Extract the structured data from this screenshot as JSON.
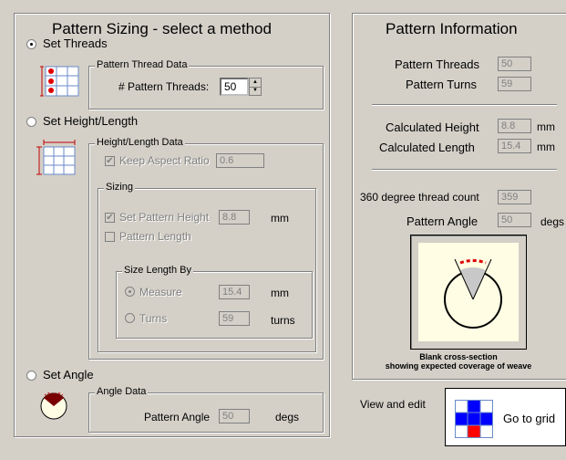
{
  "sizing": {
    "title": "Pattern Sizing - select a method",
    "set_threads": {
      "label": "Set Threads",
      "selected": true,
      "group_label": "Pattern Thread Data",
      "threads_label": "# Pattern Threads:",
      "threads_value": "50"
    },
    "set_height_length": {
      "label": "Set Height/Length",
      "selected": false,
      "group_label": "Height/Length Data",
      "keep_aspect_label": "Keep Aspect Ratio",
      "keep_aspect_checked": true,
      "aspect_value": "0.6",
      "sizing_group_label": "Sizing",
      "set_height_label": "Set Pattern Height",
      "set_height_checked": true,
      "height_value": "8.8",
      "height_unit": "mm",
      "pattern_length_label": "Pattern Length",
      "pattern_length_checked": false,
      "size_length_by_label": "Size Length By",
      "measure_label": "Measure",
      "measure_value": "15.4",
      "measure_unit": "mm",
      "turns_label": "Turns",
      "turns_value": "59",
      "turns_unit": "turns"
    },
    "set_angle": {
      "label": "Set Angle",
      "selected": false,
      "group_label": "Angle Data",
      "angle_label": "Pattern Angle",
      "angle_value": "50",
      "angle_unit": "degs"
    }
  },
  "info": {
    "title": "Pattern Information",
    "threads_label": "Pattern Threads",
    "threads_value": "50",
    "turns_label": "Pattern Turns",
    "turns_value": "59",
    "calc_height_label": "Calculated Height",
    "calc_height_value": "8.8",
    "calc_height_unit": "mm",
    "calc_length_label": "Calculated Length",
    "calc_length_value": "15.4",
    "calc_length_unit": "mm",
    "thread_count_label": "360 degree thread count",
    "thread_count_value": "359",
    "angle_label": "Pattern Angle",
    "angle_value": "50",
    "angle_unit": "degs",
    "caption_line1": "Blank cross-section",
    "caption_line2": "showing expected coverage of weave"
  },
  "view_edit": {
    "label": "View and edit",
    "button_label": "Go to grid"
  },
  "colors": {
    "background": "#d4d0c8",
    "accent_red": "#ff0000",
    "accent_blue": "#0000ff",
    "dark_red": "#7a0000",
    "preview_bg": "#fffde4"
  }
}
